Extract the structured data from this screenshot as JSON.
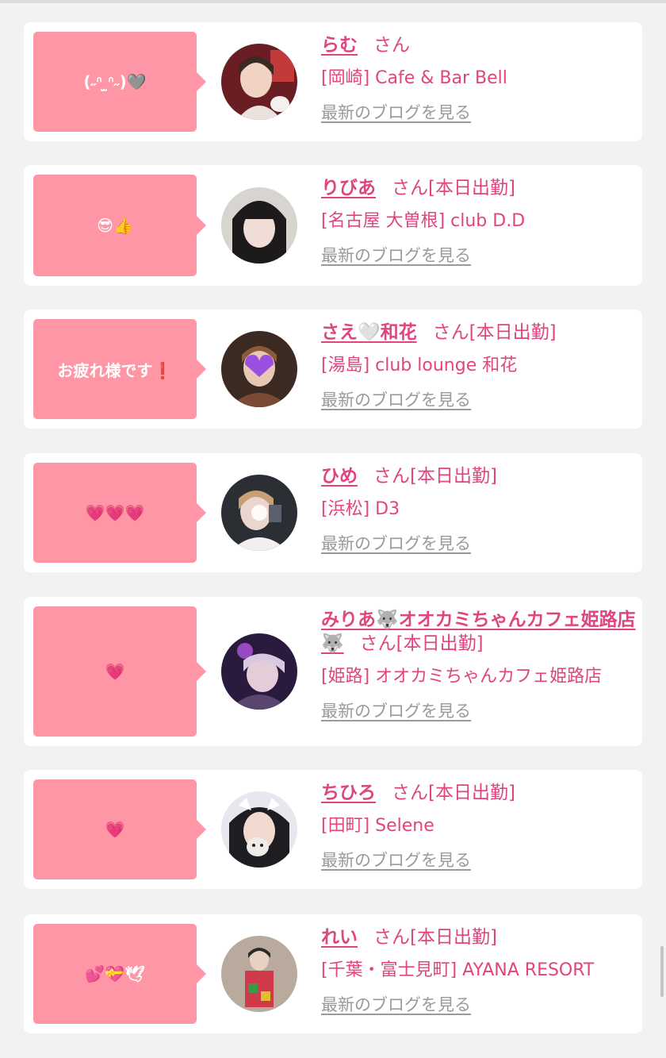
{
  "cards": [
    {
      "message": "(˶ᐢ ̫ᐢ˶)🩶",
      "name": "らむ",
      "suffix": "さん",
      "status": "",
      "shop": "[岡崎] Cafe & Bar Bell",
      "blog_link": "最新のブログを見る"
    },
    {
      "message": "😎👍",
      "name": "りびあ",
      "suffix": "さん",
      "status": "[本日出勤]",
      "shop": "[名古屋 大曽根] club D.D",
      "blog_link": "最新のブログを見る"
    },
    {
      "message": "お疲れ様です❗️",
      "name": "さえ🤍和花",
      "suffix": "さん",
      "status": "[本日出勤]",
      "shop": "[湯島] club lounge 和花",
      "blog_link": "最新のブログを見る"
    },
    {
      "message": "💗💗💗",
      "name": "ひめ",
      "suffix": "さん",
      "status": "[本日出勤]",
      "shop": "[浜松] D3",
      "blog_link": "最新のブログを見る"
    },
    {
      "message": "💗",
      "name": "みりあ🐺オオカミちゃんカフェ姫路店🐺",
      "suffix": "さん",
      "status": "[本日出勤]",
      "shop": "[姫路] オオカミちゃんカフェ姫路店",
      "blog_link": "最新のブログを見る"
    },
    {
      "message": "💗",
      "name": "ちひろ",
      "suffix": "さん",
      "status": "[本日出勤]",
      "shop": "[田町] Selene",
      "blog_link": "最新のブログを見る"
    },
    {
      "message": "💕💝🕊",
      "name": "れい",
      "suffix": "さん",
      "status": "[本日出勤]",
      "shop": "[千葉・富士見町] AYANA RESORT",
      "blog_link": "最新のブログを見る"
    }
  ],
  "colors": {
    "accent": "#e0457f",
    "bubble": "#ff96a6",
    "link_gray": "#9a9a9a",
    "background": "#f2f2f2"
  }
}
